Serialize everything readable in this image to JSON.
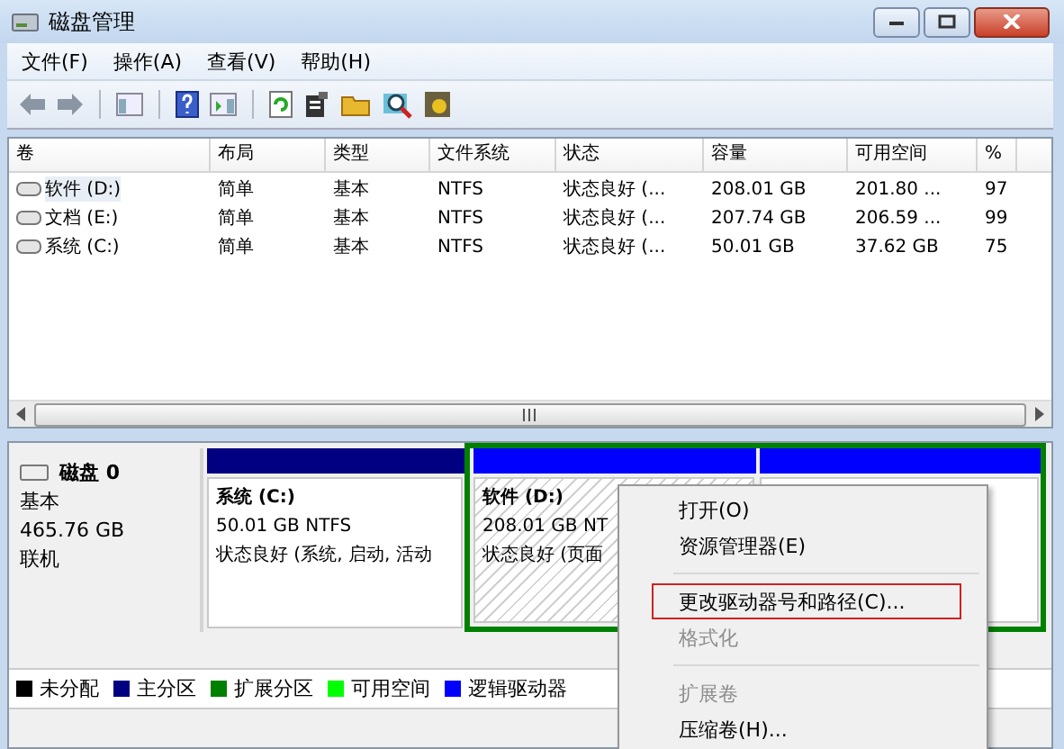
{
  "window": {
    "title": "磁盘管理"
  },
  "menu": [
    "文件(F)",
    "操作(A)",
    "查看(V)",
    "帮助(H)"
  ],
  "table": {
    "columns": [
      "卷",
      "布局",
      "类型",
      "文件系统",
      "状态",
      "容量",
      "可用空间",
      "%"
    ],
    "rows": [
      {
        "cells": [
          "软件 (D:)",
          "简单",
          "基本",
          "NTFS",
          "状态良好 (...",
          "208.01 GB",
          "201.80 ...",
          "97"
        ],
        "selected": true
      },
      {
        "cells": [
          "文档 (E:)",
          "简单",
          "基本",
          "NTFS",
          "状态良好 (...",
          "207.74 GB",
          "206.59 ...",
          "99"
        ],
        "selected": false
      },
      {
        "cells": [
          "系统 (C:)",
          "简单",
          "基本",
          "NTFS",
          "状态良好 (...",
          "50.01 GB",
          "37.62 GB",
          "75"
        ],
        "selected": false
      }
    ]
  },
  "disk": {
    "name": "磁盘 0",
    "type": "基本",
    "size": "465.76 GB",
    "status": "联机",
    "partitions": [
      {
        "kind": "primary",
        "title": "系统  (C:)",
        "size": "50.01 GB NTFS",
        "status": "状态良好 (系统, 启动, 活动",
        "selected": false
      },
      {
        "kind": "extended",
        "children": [
          {
            "kind": "logical",
            "title": "软件  (D:)",
            "size": "208.01 GB NT",
            "status": "状态良好 (页面",
            "selected": true
          },
          {
            "kind": "logical",
            "selected": false
          }
        ]
      }
    ]
  },
  "legend": [
    {
      "label": "未分配",
      "color": "#000000"
    },
    {
      "label": "主分区",
      "color": "#000080"
    },
    {
      "label": "扩展分区",
      "color": "#008000"
    },
    {
      "label": "可用空间",
      "color": "#00ff00"
    },
    {
      "label": "逻辑驱动器",
      "color": "#0000ff"
    }
  ],
  "context_menu": [
    {
      "kind": "item",
      "label": "打开(O)",
      "disabled": false,
      "highlighted": false
    },
    {
      "kind": "item",
      "label": "资源管理器(E)",
      "disabled": false,
      "highlighted": false
    },
    {
      "kind": "separator"
    },
    {
      "kind": "item",
      "label": "更改驱动器号和路径(C)...",
      "disabled": false,
      "highlighted": true
    },
    {
      "kind": "item",
      "label": "格式化",
      "disabled": true,
      "highlighted": false
    },
    {
      "kind": "separator"
    },
    {
      "kind": "item",
      "label": "扩展卷",
      "disabled": true,
      "highlighted": false
    },
    {
      "kind": "item",
      "label": "压缩卷(H)...",
      "disabled": false,
      "highlighted": false
    }
  ]
}
